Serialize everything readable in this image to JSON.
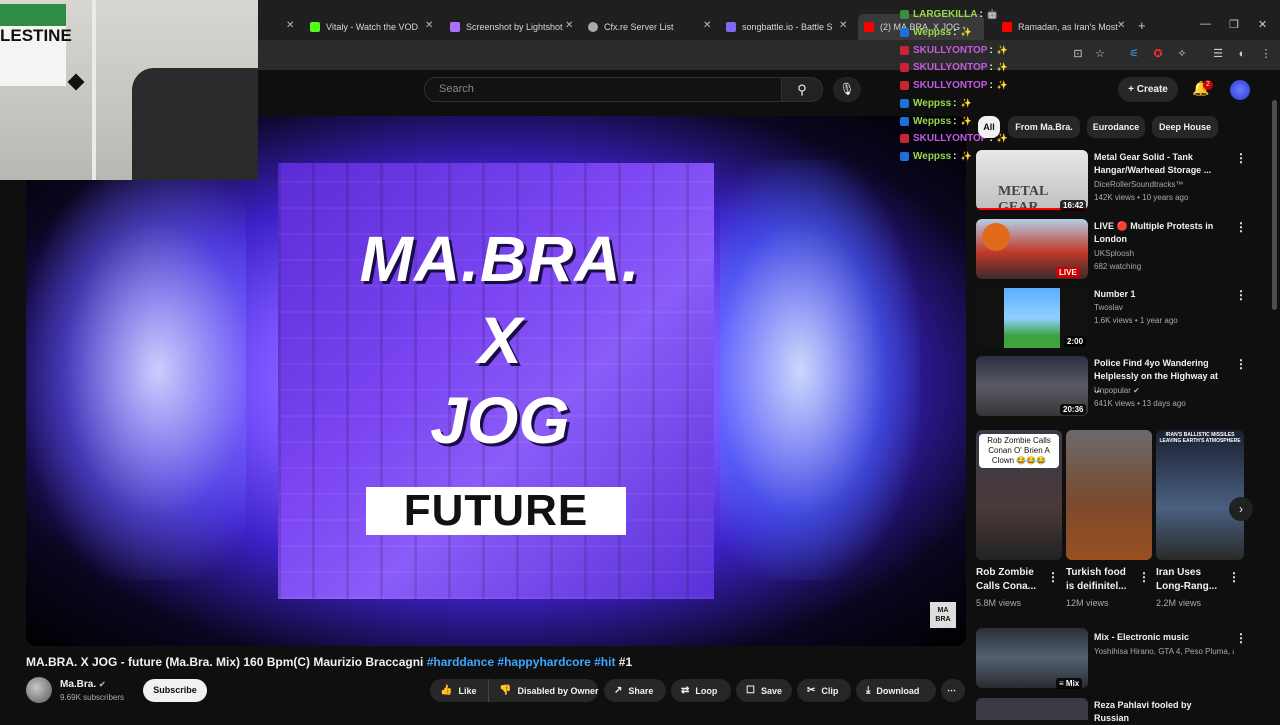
{
  "browser": {
    "tabs": [
      {
        "label": "Vitaly - Watch the VOD o",
        "color": "#53fc18"
      },
      {
        "label": "Screenshot by Lightshot",
        "color": "#a970ff"
      },
      {
        "label": "Cfx.re Server List",
        "color": "#aaaaaa"
      },
      {
        "label": "songbattle.io - Battle Son",
        "color": "#7c6cf0"
      },
      {
        "label": "(2) MA.BRA. X JOG - ",
        "color": "#ff0000"
      },
      {
        "label": "Ramadan, as Iran's Most I",
        "color": "#ff0000"
      }
    ],
    "new_tab_label": "+"
  },
  "webcam": {
    "poster_text": "LESTINE"
  },
  "chat": [
    {
      "user": "LARGEKILLA",
      "color": "#9ad94a",
      "badge": "#3a8f3a"
    },
    {
      "user": "Weppss",
      "color": "#9ad94a",
      "badge": "#1e6fd9"
    },
    {
      "user": "SKULLYONTOP",
      "color": "#c45ae0",
      "badge": "#cc2233"
    },
    {
      "user": "SKULLYONTOP",
      "color": "#c45ae0",
      "badge": "#cc2233"
    },
    {
      "user": "SKULLYONTOP",
      "color": "#c45ae0",
      "badge": "#cc2233"
    },
    {
      "user": "Weppss",
      "color": "#9ad94a",
      "badge": "#1e6fd9"
    },
    {
      "user": "Weppss",
      "color": "#9ad94a",
      "badge": "#1e6fd9"
    },
    {
      "user": "SKULLYONTOP",
      "color": "#c45ae0",
      "badge": "#cc2233"
    },
    {
      "user": "Weppss",
      "color": "#9ad94a",
      "badge": "#1e6fd9"
    }
  ],
  "header": {
    "search_placeholder": "Search",
    "create_label": "Create",
    "notification_count": "2"
  },
  "cover": {
    "line1": "MA.BRA.",
    "line2": "X",
    "line3": "JOG",
    "line4": "FUTURE",
    "watermark": "MA BRA"
  },
  "chips": [
    "All",
    "From Ma.Bra.",
    "Eurodance",
    "Deep House"
  ],
  "sidebar": [
    {
      "title": "Metal Gear Solid - Tank Hangar/Warhead Storage ...",
      "channel": "DiceRollerSoundtracks™",
      "meta": "142K views • 10 years ago",
      "duration": "16:42"
    },
    {
      "title": "LIVE 🔴 Multiple Protests in London",
      "channel": "UKSploosh",
      "meta": "682 watching",
      "duration": "LIVE"
    },
    {
      "title": "Number 1",
      "channel": "Twoslav",
      "meta": "1.6K views • 1 year ago",
      "duration": "2:00"
    },
    {
      "title": "Police Find 4yo Wandering Helplessly on the Highway at ...",
      "channel": "Unpopular",
      "meta": "641K views • 13 days ago",
      "duration": "20:36"
    }
  ],
  "shorts": [
    {
      "title": "Rob Zombie Calls Cona...",
      "views": "5.8M views",
      "caption": "Rob Zombie Calls Conan O' Brien A Clown 😂😂😂"
    },
    {
      "title": "Turkish food is deifinitel...",
      "views": "12M views",
      "caption": ""
    },
    {
      "title": "Iran Uses Long-Rang...",
      "views": "2.2M views",
      "caption": "IRAN'S BALLISTIC MISSILES LEAVING EARTH'S ATMOSPHERE"
    }
  ],
  "mix": {
    "title": "Mix - Electronic music",
    "meta": "Yoshihisa Hirano, GTA 4, Peso Pluma, an...",
    "badge": "Mix"
  },
  "next_item_title": "Reza Pahlavi fooled by Russian",
  "video": {
    "title_prefix": "MA.BRA. X JOG - future (Ma.Bra. Mix) 160 Bpm(C) Maurizio Braccagni ",
    "tags": "#harddance #happyhardcore #hit",
    "title_suffix": " #1",
    "channel": "Ma.Bra.",
    "subscribers": "9.69K subscribers",
    "subscribe_label": "Subscribe"
  },
  "actions": {
    "like": "Like",
    "dislike": "Disabled by Owner",
    "share": "Share",
    "loop": "Loop",
    "save": "Save",
    "clip": "Clip",
    "download": "Download"
  }
}
